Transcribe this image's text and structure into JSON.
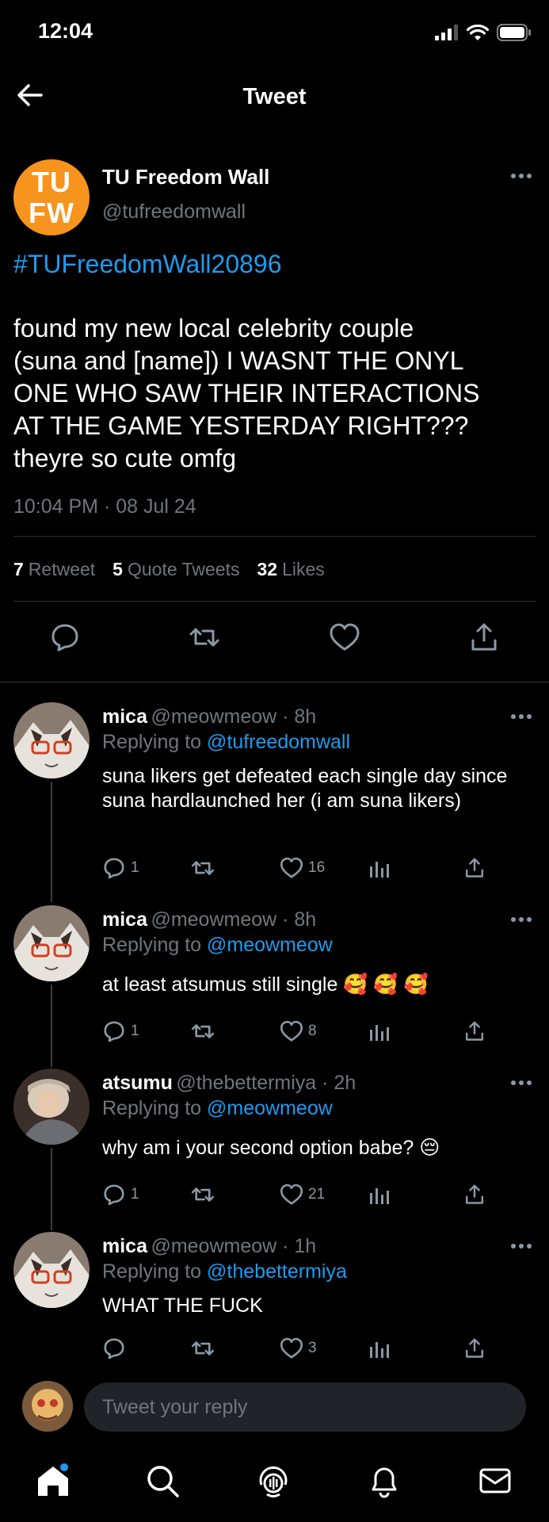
{
  "status_bar": {
    "time": "12:04"
  },
  "header": {
    "title": "Tweet"
  },
  "main_tweet": {
    "avatar_text_top": "TU",
    "avatar_text_bottom": "FW",
    "author_name": "TU Freedom Wall",
    "author_handle": "@tufreedomwall",
    "hashtag": "#TUFreedomWall20896",
    "body": "found my new local celebrity couple\n(suna and [name]) I WASNT THE ONYL\nONE WHO SAW THEIR INTERACTIONS\nAT THE GAME YESTERDAY RIGHT???\ntheyre so cute omfg",
    "timestamp": "10:04 PM · 08 Jul 24",
    "retweets_count": "7",
    "retweets_label": "Retweet",
    "quotes_count": "5",
    "quotes_label": "Quote Tweets",
    "likes_count": "32",
    "likes_label": "Likes",
    "accent_color": "#f7941d"
  },
  "replies": [
    {
      "name": "mica",
      "handle_time": "@meowmeow · 8h",
      "replying_prefix": "Replying to",
      "replying_to": "@tufreedomwall",
      "text": "suna likers get defeated each single day since suna hardlaunched her (i am suna likers)",
      "reply_count": "1",
      "retweet_count": "",
      "like_count": "16"
    },
    {
      "name": "mica",
      "handle_time": "@meowmeow · 8h",
      "replying_prefix": "Replying to",
      "replying_to": "@meowmeow",
      "text": "at least atsumus still single 🥰 🥰 🥰",
      "reply_count": "1",
      "retweet_count": "",
      "like_count": "8"
    },
    {
      "name": "atsumu",
      "handle_time": "@thebettermiya · 2h",
      "replying_prefix": "Replying to",
      "replying_to": "@meowmeow",
      "text": "why am i your second option babe? 😔",
      "reply_count": "1",
      "retweet_count": "",
      "like_count": "21"
    },
    {
      "name": "mica",
      "handle_time": "@meowmeow · 1h",
      "replying_prefix": "Replying to",
      "replying_to": "@thebettermiya",
      "text": "WHAT THE FUCK",
      "reply_count": "",
      "retweet_count": "",
      "like_count": "3"
    }
  ],
  "composer": {
    "placeholder": "Tweet your reply"
  },
  "tabbar": {
    "items": [
      "home-icon",
      "search-icon",
      "spaces-icon",
      "notifications-icon",
      "messages-icon"
    ]
  },
  "colors": {
    "link": "#1d9bf0",
    "muted": "#71767b",
    "background": "#000000"
  }
}
